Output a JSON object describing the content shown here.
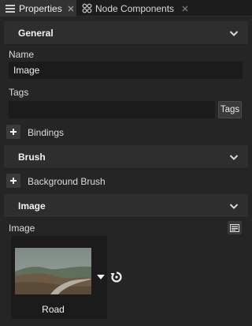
{
  "tabs": [
    {
      "label": "Properties",
      "active": true
    },
    {
      "label": "Node Components",
      "active": false
    }
  ],
  "sections": {
    "general": {
      "title": "General"
    },
    "brush": {
      "title": "Brush"
    },
    "image": {
      "title": "Image"
    }
  },
  "fields": {
    "name_label": "Name",
    "name_value": "Image",
    "tags_label": "Tags",
    "tags_value": "",
    "tags_button": "Tags"
  },
  "rows": {
    "bindings": "Bindings",
    "background_brush": "Background Brush"
  },
  "image_prop": {
    "label": "Image",
    "asset_name": "Road"
  },
  "colors": {
    "panel_bg": "#252526",
    "section_bg": "#2e2e2e",
    "field_bg": "#1b1b1b",
    "text": "#e4e4e4"
  }
}
